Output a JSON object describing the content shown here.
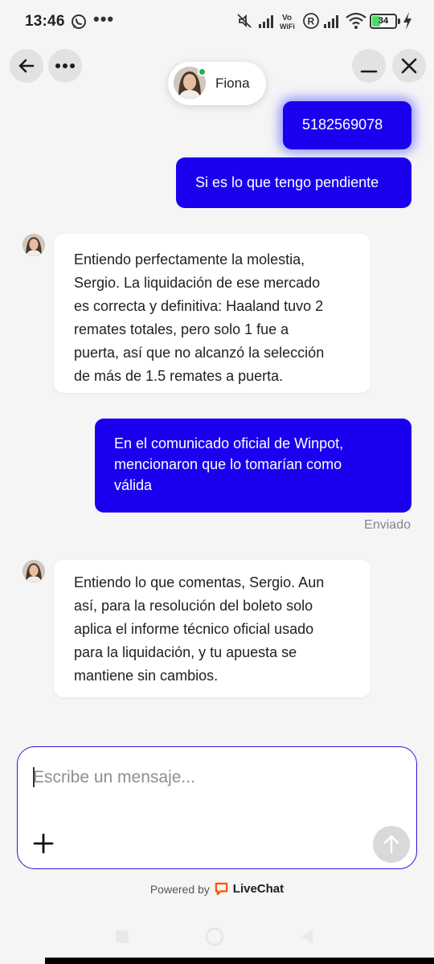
{
  "status_bar": {
    "time": "13:46",
    "battery": "34",
    "more": "•••",
    "volte_label": "Vo\nWiFi",
    "r_label": "R"
  },
  "header": {
    "agent_name": "Fiona",
    "agent_online": true
  },
  "messages": [
    {
      "from": "user",
      "lines": [
        "5182569078"
      ]
    },
    {
      "from": "user",
      "lines": [
        "Si es lo que tengo pendiente"
      ]
    },
    {
      "from": "agent",
      "lines": [
        "Entiendo perfectamente la molestia,",
        "Sergio. La liquidación de ese mercado",
        "es correcta y definitiva: Haaland tuvo 2",
        "remates totales, pero solo 1 fue a",
        "puerta, así que no alcanzó la selección",
        "de más de 1.5 remates a puerta."
      ]
    },
    {
      "from": "user",
      "lines": [
        "En el comunicado oficial de Winpot,",
        "mencionaron que lo tomarían como",
        "válida"
      ]
    },
    {
      "from": "agent",
      "lines": [
        "Entiendo lo que comentas, Sergio. Aun",
        "así, para la resolución del boleto solo",
        "aplica el informe técnico oficial usado",
        "para la liquidación, y tu apuesta se",
        "mantiene sin cambios."
      ]
    }
  ],
  "delivery_status": "Enviado",
  "composer": {
    "placeholder": "Escribe un mensaje...",
    "value": ""
  },
  "footer": {
    "powered_by": "Powered by",
    "brand": "LiveChat"
  },
  "colors": {
    "user_bubble": "#1a00ee",
    "background": "#f5f5f6",
    "brand_orange": "#ff5100",
    "online": "#22b14c"
  },
  "icons": {
    "back": "arrow-left-icon",
    "menu": "more-horizontal-icon",
    "minimize": "minimize-icon",
    "close": "close-icon",
    "add": "plus-icon",
    "send": "arrow-up-icon"
  }
}
